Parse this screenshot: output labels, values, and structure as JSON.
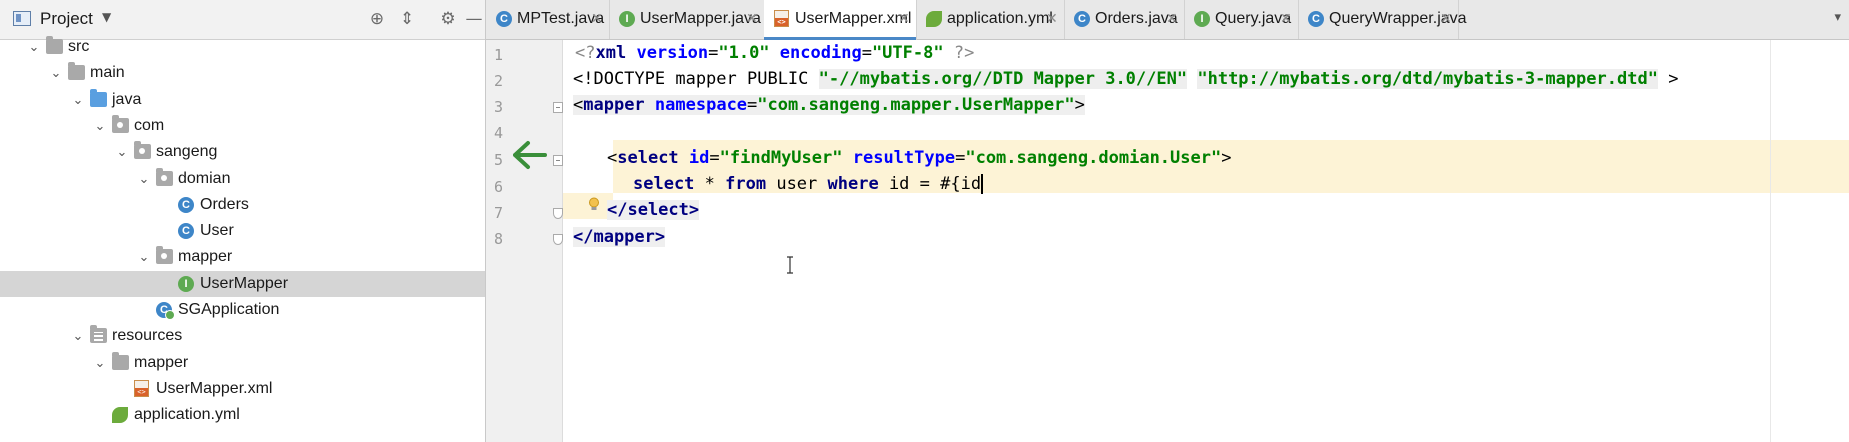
{
  "project_panel": {
    "title": "Project",
    "tree": [
      {
        "label": "src",
        "icon": "folder-icon",
        "depth": 0,
        "expanded": true
      },
      {
        "label": "main",
        "icon": "folder-icon",
        "depth": 1,
        "expanded": true
      },
      {
        "label": "java",
        "icon": "source-folder-icon",
        "depth": 2,
        "expanded": true
      },
      {
        "label": "com",
        "icon": "package-icon",
        "depth": 3,
        "expanded": true
      },
      {
        "label": "sangeng",
        "icon": "package-icon",
        "depth": 4,
        "expanded": true
      },
      {
        "label": "domian",
        "icon": "package-icon",
        "depth": 5,
        "expanded": true
      },
      {
        "label": "Orders",
        "icon": "class-icon",
        "depth": 6
      },
      {
        "label": "User",
        "icon": "class-icon",
        "depth": 6
      },
      {
        "label": "mapper",
        "icon": "package-icon",
        "depth": 5,
        "expanded": true
      },
      {
        "label": "UserMapper",
        "icon": "interface-icon",
        "depth": 6,
        "selected": true
      },
      {
        "label": "SGApplication",
        "icon": "spring-boot-class-icon",
        "depth": 5
      },
      {
        "label": "resources",
        "icon": "resources-folder-icon",
        "depth": 2,
        "expanded": true
      },
      {
        "label": "mapper",
        "icon": "folder-icon",
        "depth": 3,
        "expanded": true
      },
      {
        "label": "UserMapper.xml",
        "icon": "xml-file-icon",
        "depth": 4
      },
      {
        "label": "application.yml",
        "icon": "yaml-file-icon",
        "depth": 3
      }
    ]
  },
  "tabs": [
    {
      "label": "MPTest.java",
      "icon": "c"
    },
    {
      "label": "UserMapper.java",
      "icon": "i"
    },
    {
      "label": "UserMapper.xml",
      "icon": "x",
      "active": true
    },
    {
      "label": "application.yml",
      "icon": "y"
    },
    {
      "label": "Orders.java",
      "icon": "c"
    },
    {
      "label": "Query.java",
      "icon": "i"
    },
    {
      "label": "QueryWrapper.java",
      "icon": "c"
    }
  ],
  "editor": {
    "line_numbers": [
      "1",
      "2",
      "3",
      "4",
      "5",
      "6",
      "7",
      "8"
    ],
    "lines": {
      "l1": {
        "open": "<?",
        "tag": "xml",
        "a1": "version",
        "v1": "\"1.0\"",
        "a2": "encoding",
        "v2": "\"UTF-8\"",
        "close": "?>"
      },
      "l2": {
        "open": "<!DOCTYPE mapper PUBLIC ",
        "p1": "\"-//mybatis.org//DTD Mapper 3.0//EN\"",
        "p2": "\"http://mybatis.org/dtd/mybatis-3-mapper.dtd\"",
        "close": ">"
      },
      "l3": {
        "open": "<",
        "tag": "mapper",
        "a1": "namespace",
        "v1": "\"com.sangeng.mapper.UserMapper\"",
        "close": ">"
      },
      "l5": {
        "open": "<",
        "tag": "select",
        "a1": "id",
        "v1": "\"findMyUser\"",
        "a2": "resultType",
        "v2": "\"com.sangeng.domian.User\"",
        "close": ">"
      },
      "l6": {
        "kw1": "select",
        "t1": " * ",
        "kw2": "from",
        "t2": " user ",
        "kw3": "where",
        "t3": " id = #{id"
      },
      "l7": {
        "text": "</select>"
      },
      "l8": {
        "text": "</mapper>"
      }
    }
  }
}
